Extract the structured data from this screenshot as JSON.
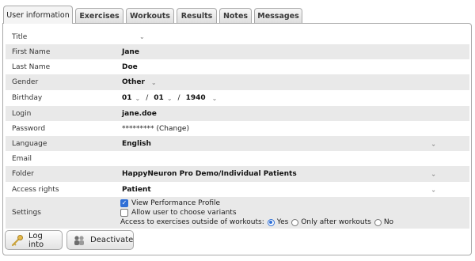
{
  "tabs": [
    {
      "label": "User information"
    },
    {
      "label": "Exercises"
    },
    {
      "label": "Workouts"
    },
    {
      "label": "Results"
    },
    {
      "label": "Notes"
    },
    {
      "label": "Messages"
    }
  ],
  "fields": {
    "title": {
      "label": "Title",
      "value": ""
    },
    "first_name": {
      "label": "First Name",
      "value": "Jane"
    },
    "last_name": {
      "label": "Last Name",
      "value": "Doe"
    },
    "gender": {
      "label": "Gender",
      "value": "Other"
    },
    "birthday": {
      "label": "Birthday",
      "day": "01",
      "month": "01",
      "year": "1940",
      "separator": "/"
    },
    "login": {
      "label": "Login",
      "value": "jane.doe"
    },
    "password": {
      "label": "Password",
      "masked": "*********",
      "change_link": "(Change)"
    },
    "language": {
      "label": "Language",
      "value": "English"
    },
    "email": {
      "label": "Email",
      "value": ""
    },
    "folder": {
      "label": "Folder",
      "value": "HappyNeuron Pro Demo/Individual Patients"
    },
    "access_rights": {
      "label": "Access rights",
      "value": "Patient"
    }
  },
  "settings": {
    "label": "Settings",
    "view_performance_profile": {
      "label": "View Performance Profile",
      "checked": true
    },
    "allow_variants": {
      "label": "Allow user to choose variants",
      "checked": false
    },
    "access_outside": {
      "label": "Access to exercises outside of workouts:",
      "options": [
        "Yes",
        "Only after workouts",
        "No"
      ],
      "selected": "Yes"
    }
  },
  "buttons": {
    "log_into": "Log into",
    "deactivate": "Deactivate"
  },
  "colors": {
    "row_shade": "#e9e9e9",
    "accent": "#2f6fd6",
    "border": "#a9a9a9"
  },
  "icons": {
    "dropdown": "chevron-down-icon",
    "log_into": "key-icon",
    "deactivate": "users-icon"
  }
}
